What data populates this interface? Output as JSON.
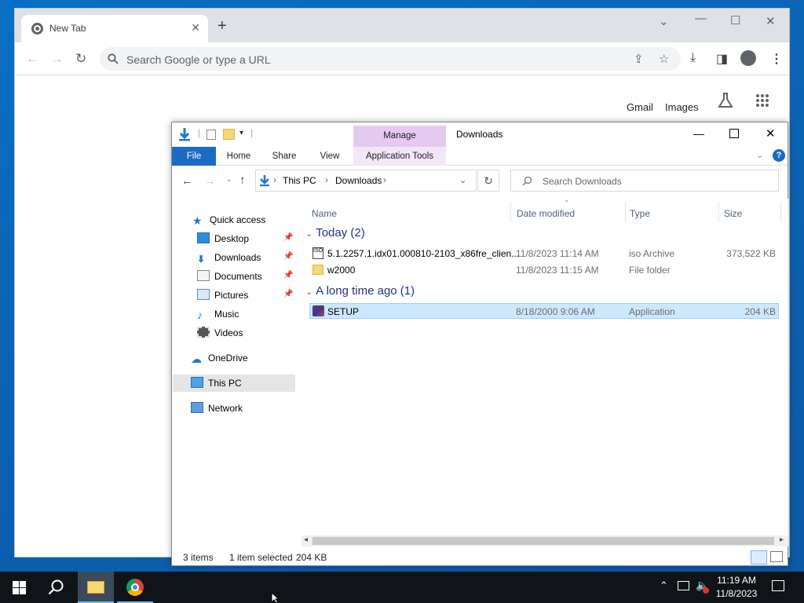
{
  "chrome": {
    "tab_title": "New Tab",
    "omnibox_placeholder": "Search Google or type a URL",
    "ntp_links": {
      "gmail": "Gmail",
      "images": "Images"
    }
  },
  "explorer": {
    "window_title": "Downloads",
    "ribbon": {
      "manage": "Manage",
      "tabs": [
        "File",
        "Home",
        "Share",
        "View",
        "Application Tools"
      ]
    },
    "address": {
      "crumbs": [
        "This PC",
        "Downloads"
      ]
    },
    "search_placeholder": "Search Downloads",
    "nav": {
      "quick_access": "Quick access",
      "items": [
        "Desktop",
        "Downloads",
        "Documents",
        "Pictures",
        "Music",
        "Videos"
      ],
      "onedrive": "OneDrive",
      "this_pc": "This PC",
      "network": "Network"
    },
    "columns": [
      "Name",
      "Date modified",
      "Type",
      "Size"
    ],
    "groups": [
      {
        "label": "Today (2)",
        "files": [
          {
            "name": "5.1.2257.1.idx01.000810-2103_x86fre_clien...",
            "date": "11/8/2023 11:14 AM",
            "type": "iso Archive",
            "size": "373,522 KB"
          },
          {
            "name": "w2000",
            "date": "11/8/2023 11:15 AM",
            "type": "File folder",
            "size": ""
          }
        ]
      },
      {
        "label": "A long time ago (1)",
        "files": [
          {
            "name": "SETUP",
            "date": "8/18/2000 9:06 AM",
            "type": "Application",
            "size": "204 KB"
          }
        ]
      }
    ],
    "status": {
      "count": "3 items",
      "selected": "1 item selected",
      "size": "204 KB"
    }
  },
  "taskbar": {
    "time": "11:19 AM",
    "date": "11/8/2023"
  },
  "colors": {
    "accent": "#1a73e8",
    "file_tab": "#1a6bc2",
    "selection": "#cce8ff",
    "manage": "#e6c9f0"
  }
}
